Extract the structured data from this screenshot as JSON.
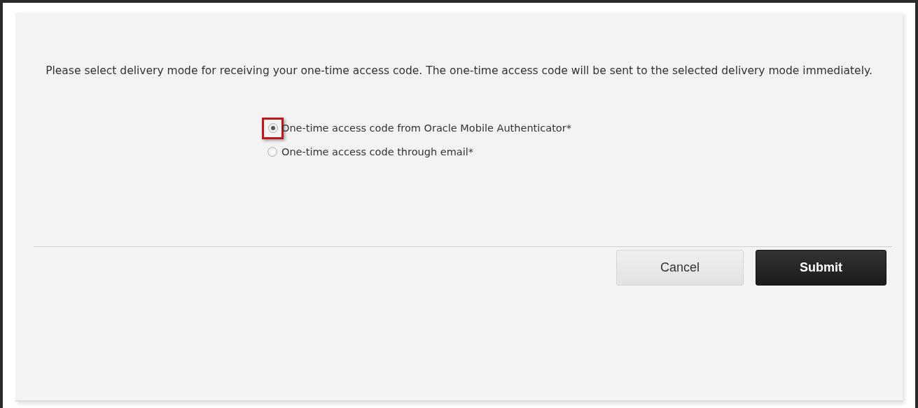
{
  "instructions": "Please select delivery mode for receiving your one-time access code. The one-time access code will be sent to the selected delivery mode immediately.",
  "options": [
    {
      "label": "One-time access code from Oracle Mobile Authenticator*",
      "selected": true,
      "highlighted": true
    },
    {
      "label": "One-time access code through email*",
      "selected": false,
      "highlighted": false
    }
  ],
  "buttons": [
    {
      "label": "Cancel",
      "kind": "secondary"
    },
    {
      "label": "Submit",
      "kind": "primary"
    }
  ]
}
